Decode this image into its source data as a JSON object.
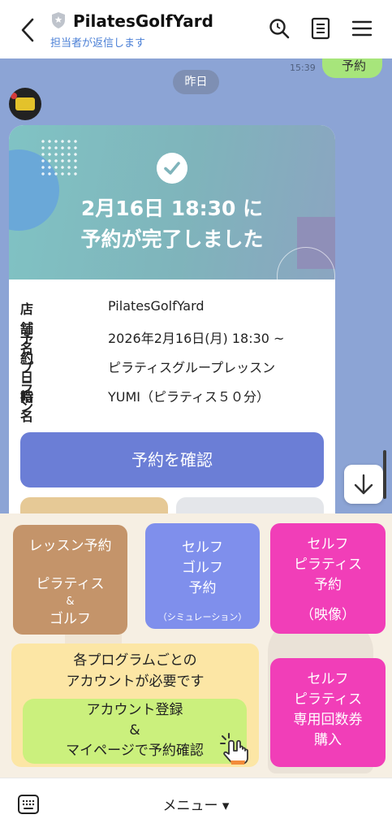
{
  "header": {
    "title": "PilatesGolfYard",
    "subtitle": "担当者が返信します"
  },
  "chat": {
    "sent_bubble_text": "予約",
    "sent_time": "15:39",
    "date_divider": "昨日"
  },
  "card": {
    "hero_line1": "2月16日 18:30 に",
    "hero_line2": "予約が完了しました",
    "rows": [
      {
        "label": "店舗名",
        "value": "PilatesGolfYard"
      },
      {
        "label": "予約日時",
        "value": "2026年2月16日(月) 18:30 ~"
      },
      {
        "label": "プラン",
        "value": "ピラティスグループレッスン"
      },
      {
        "label": "指名",
        "value": "YUMI（ピラティス５０分）"
      }
    ],
    "confirm_button": "予約を確認"
  },
  "rich_menu": {
    "lesson": {
      "line1": "レッスン予約",
      "line2": "ピラティス",
      "line3": "&",
      "line4": "ゴルフ"
    },
    "self_golf": {
      "line1": "セルフ",
      "line2": "ゴルフ",
      "line3": "予約",
      "note": "（シミュレーション）"
    },
    "self_pilates": {
      "line1": "セルフ",
      "line2": "ピラティス",
      "line3": "予約",
      "line4": "（映像）"
    },
    "account_note_line1": "各プログラムごとの",
    "account_note_line2": "アカウントが必要です",
    "account_button": {
      "line1": "アカウント登録",
      "line2": "&",
      "line3": "マイページで予約確認"
    },
    "ticket": {
      "line1": "セルフ",
      "line2": "ピラティス",
      "line3": "専用回数券",
      "line4": "購入"
    }
  },
  "bottom_bar": {
    "menu_label": "メニュー ▾"
  },
  "colors": {
    "chat_bg": "#8ca4d5",
    "confirm_button": "#6b7ed6",
    "lesson_button": "#c4946a",
    "golf_button": "#7f8fec",
    "pilates_button": "#f13eb8",
    "account_button": "#cbf07d",
    "sent_bubble": "#a7e57b"
  },
  "icons": [
    "back-arrow-icon",
    "shield-icon",
    "search-icon",
    "notes-icon",
    "hamburger-menu-icon",
    "check-icon",
    "arrow-down-icon",
    "pointing-hand-icon",
    "keyboard-icon"
  ]
}
